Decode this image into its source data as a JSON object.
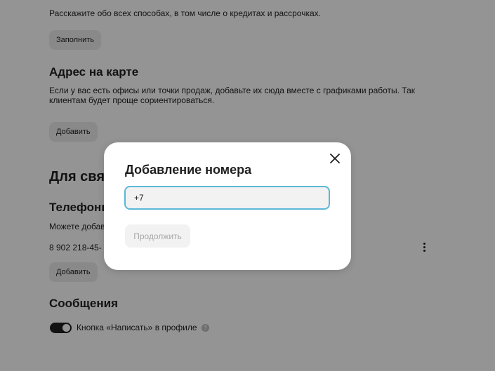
{
  "payment": {
    "description": "Расскажите обо всех способах, в том числе о кредитах и рассрочках.",
    "fill_button": "Заполнить"
  },
  "map_address": {
    "title": "Адрес на карте",
    "description_line1": "Если у вас есть офисы или точки продаж, добавьте их сюда вместе с графиками работы. Так",
    "description_line2": "клиентам будет проще сориентироваться.",
    "add_button": "Добавить"
  },
  "contacts": {
    "title": "Для свя",
    "phones": {
      "title": "Телефоны",
      "description": "Можете добав",
      "phone_number": "8 902 218-45-",
      "add_button": "Добавить"
    }
  },
  "messages": {
    "title": "Сообщения",
    "toggle_label": "Кнопка «Написать» в профиле",
    "toggle_on": true,
    "info_glyph": "?"
  },
  "modal": {
    "title": "Добавление номера",
    "phone_value": "+7",
    "continue_button": "Продолжить",
    "close_icon": "close-icon"
  },
  "colors": {
    "overlay": "#000000",
    "input_focus_border": "#5bb8d6",
    "toggle_active": "#1f1f1f",
    "disabled_text": "#a8a8a8"
  }
}
